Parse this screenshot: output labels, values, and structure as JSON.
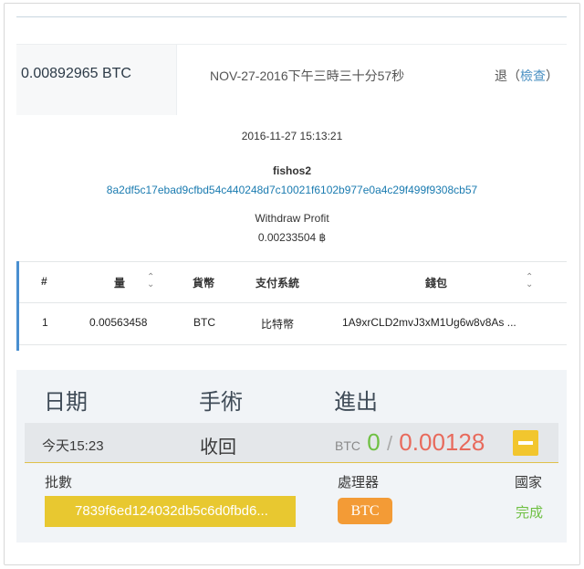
{
  "transaction": {
    "amount": "0.00892965 BTC",
    "datetime": "NOV-27-2016下午三時三十分57秒",
    "status": "退",
    "status_link_open": "（",
    "status_link": "檢查",
    "status_link_close": "）"
  },
  "detail": {
    "timestamp": "2016-11-27 15:13:21",
    "user": "fishos2",
    "hash": "8a2df5c17ebad9cfbd54c440248d7c10021f6102b977e0a4c29f499f9308cb57",
    "kind": "Withdraw Profit",
    "profit": "0.00233504 ฿"
  },
  "table": {
    "columns": [
      "#",
      "量",
      "貨幣",
      "支付系統",
      "錢包"
    ],
    "rows": [
      {
        "index": "1",
        "amount": "0.00563458",
        "currency": "BTC",
        "system": "比特幣",
        "wallet": "1A9xrCLD2mvJ3xM1Ug6w8v8As ..."
      }
    ]
  },
  "panel": {
    "headers": {
      "date": "日期",
      "operation": "手術",
      "io": "進出"
    },
    "entry": {
      "date": "今天15:23",
      "operation": "收回",
      "currency": "BTC",
      "in": "0",
      "separator": "/",
      "out": "0.00128"
    },
    "labels": {
      "batch": "批數",
      "processor": "處理器",
      "country": "國家"
    },
    "batch_id": "7839f6ed124032db5c6d0fbd6...",
    "processor_badge": "BTC",
    "country_status": "完成",
    "colors": {
      "accent_yellow": "#e8c830",
      "badge_orange": "#f39b36",
      "green": "#6fc043",
      "red": "#e86a5c"
    }
  }
}
